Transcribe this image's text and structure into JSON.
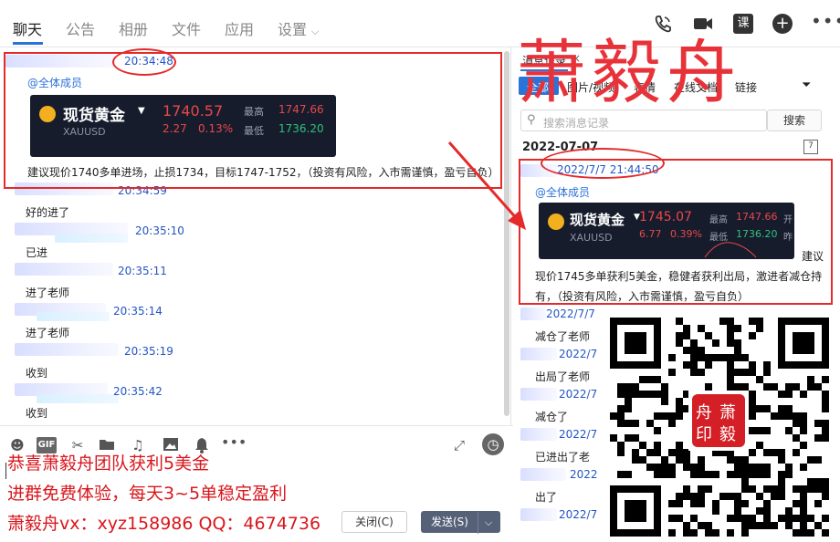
{
  "tabs": [
    "聊天",
    "公告",
    "相册",
    "文件",
    "应用",
    "设置"
  ],
  "top_icons": [
    "phone-icon",
    "video-icon",
    "course-icon",
    "add-icon",
    "more-icon"
  ],
  "course_label": "课",
  "chat": {
    "first_time": "20:34:48",
    "mention": "@全体成员",
    "card": {
      "name": "现货黄金",
      "code": "XAUUSD",
      "price": "1740.57",
      "change": "2.27",
      "change_pct": "0.13%",
      "high_label": "最高",
      "high": "1747.66",
      "low_label": "最低",
      "low": "1736.20"
    },
    "advice": "建议现价1740多单进场，止损1734，目标1747-1752，（投资有风险，入市需谨慎，盈亏自负）",
    "messages": [
      {
        "time": "20:34:59",
        "text": "好的进了"
      },
      {
        "time": "20:35:10",
        "text": "已进"
      },
      {
        "time": "20:35:11",
        "text": "进了老师"
      },
      {
        "time": "20:35:14",
        "text": "进了老师"
      },
      {
        "time": "20:35:19",
        "text": "收到"
      },
      {
        "time": "20:35:42",
        "text": "收到"
      }
    ]
  },
  "input": {
    "promo_lines": [
      "恭喜萧毅舟团队获利5美金",
      "进群免费体验，每天3~5单稳定盈利",
      "萧毅舟vx：xyz158986 QQ：4674736"
    ],
    "close_label": "关闭(C)",
    "send_label": "发送(S)"
  },
  "history": {
    "title": "消息记录",
    "filters": [
      "全部",
      "图片/视频",
      "表情",
      "在线文档",
      "链接"
    ],
    "search_placeholder": "搜索消息记录",
    "search_button": "搜索",
    "date": "2022-07-07",
    "calendar_day": "7",
    "highlight_time": "2022/7/7 21:44:50",
    "mention": "@全体成员",
    "card": {
      "name": "现货黄金",
      "code": "XAUUSD",
      "price": "1745.07",
      "change": "6.77",
      "change_pct": "0.39%",
      "high_label": "最高",
      "high": "1747.66",
      "low_label": "最低",
      "low": "1736.20",
      "open_label": "开",
      "close_label": "昨"
    },
    "advice_tail": "建议",
    "advice_lines": [
      "现价1745多单获利5美金，稳健者获利出局，激进者减仓持",
      "有，（投资有风险，入市需谨慎，盈亏自负）"
    ],
    "items": [
      {
        "time": "2022/7/7",
        "text": "减仓了老师"
      },
      {
        "time": "2022/7",
        "text": "出局了老师"
      },
      {
        "time": "2022/7",
        "text": "减仓了"
      },
      {
        "time": "2022/7",
        "text": "已进出了老"
      },
      {
        "time": "2022",
        "text": "出了"
      },
      {
        "time": "2022/7",
        "text": ""
      }
    ]
  },
  "watermark": "萧毅舟",
  "seal": [
    "舟",
    "萧",
    "印",
    "毅"
  ]
}
